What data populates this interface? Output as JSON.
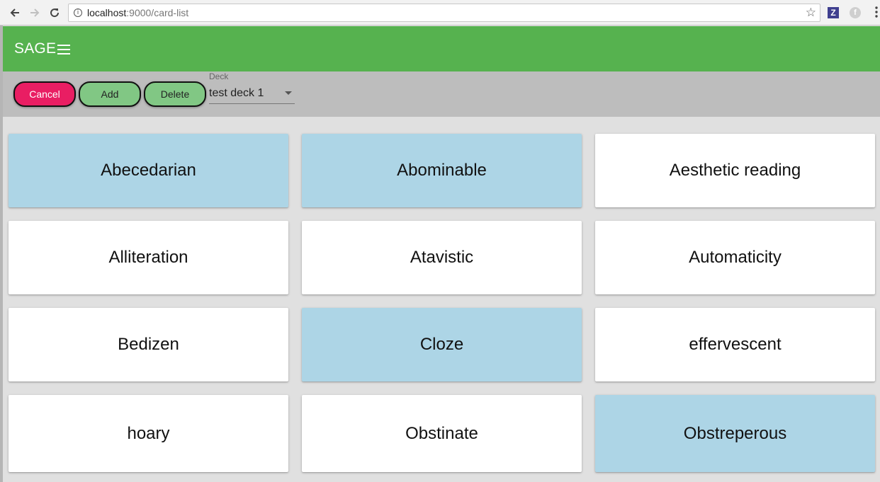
{
  "browser": {
    "url_host": "localhost",
    "url_path": ":9000/card-list",
    "ext_z": "Z",
    "ext_f": "f"
  },
  "app": {
    "title": "SAGE"
  },
  "toolbar": {
    "cancel_label": "Cancel",
    "add_label": "Add",
    "delete_label": "Delete",
    "deck_label": "Deck",
    "deck_value": "test deck 1"
  },
  "colors": {
    "app_bar": "#56b24f",
    "cancel": "#e91e63",
    "add_delete": "#81c784",
    "selected_card": "#add5e6"
  },
  "cards": [
    {
      "label": "Abecedarian",
      "selected": true
    },
    {
      "label": "Abominable",
      "selected": true
    },
    {
      "label": "Aesthetic reading",
      "selected": false
    },
    {
      "label": "Alliteration",
      "selected": false
    },
    {
      "label": "Atavistic",
      "selected": false
    },
    {
      "label": "Automaticity",
      "selected": false
    },
    {
      "label": "Bedizen",
      "selected": false
    },
    {
      "label": "Cloze",
      "selected": true
    },
    {
      "label": "effervescent",
      "selected": false
    },
    {
      "label": "hoary",
      "selected": false
    },
    {
      "label": "Obstinate",
      "selected": false
    },
    {
      "label": "Obstreperous",
      "selected": true
    }
  ]
}
